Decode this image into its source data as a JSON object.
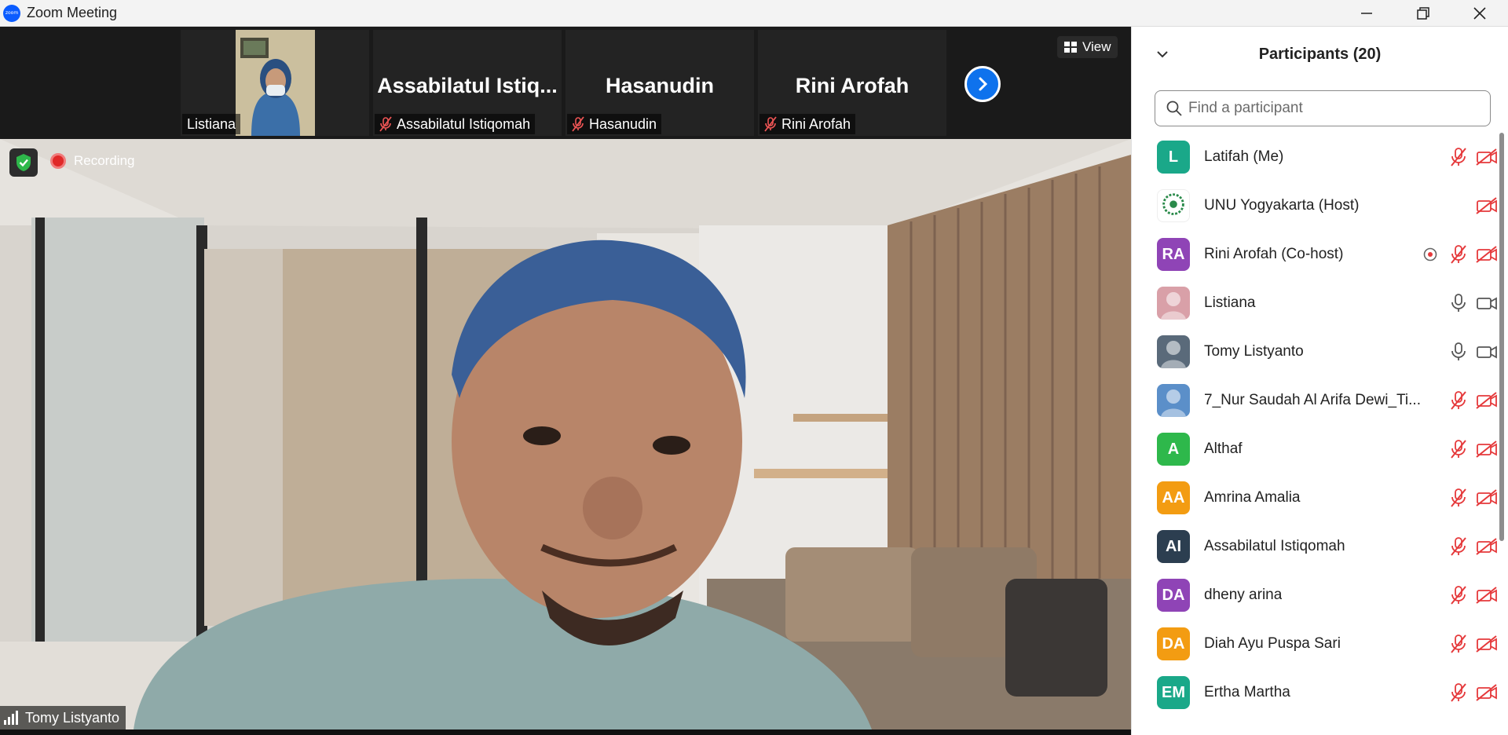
{
  "window": {
    "title": "Zoom Meeting",
    "logo_text": "zoom"
  },
  "gallery": {
    "tiles": [
      {
        "bigname": "",
        "tag": "Listiana",
        "muted": false
      },
      {
        "bigname": "Assabilatul  Istiq...",
        "tag": "Assabilatul Istiqomah",
        "muted": true
      },
      {
        "bigname": "Hasanudin",
        "tag": "Hasanudin",
        "muted": true
      },
      {
        "bigname": "Rini Arofah",
        "tag": "Rini Arofah",
        "muted": true
      }
    ],
    "view_label": "View"
  },
  "main": {
    "recording_label": "Recording",
    "speaker_name": "Tomy Listyanto"
  },
  "panel": {
    "title": "Participants (20)",
    "search_placeholder": "Find a participant",
    "participants": [
      {
        "name": "Latifah (Me)",
        "initials": "L",
        "color": "#1aa889",
        "mic": "muted",
        "video": "off",
        "record": false
      },
      {
        "name": "UNU Yogyakarta (Host)",
        "initials": "",
        "color": "#ffffff",
        "mic": "none",
        "video": "off",
        "record": false
      },
      {
        "name": "Rini Arofah (Co-host)",
        "initials": "RA",
        "color": "#8f44b6",
        "mic": "muted",
        "video": "off",
        "record": true
      },
      {
        "name": "Listiana",
        "initials": "",
        "color": "#d9a0a8",
        "mic": "on",
        "video": "on",
        "record": false
      },
      {
        "name": "Tomy Listyanto",
        "initials": "",
        "color": "#5a6a7a",
        "mic": "on",
        "video": "on",
        "record": false
      },
      {
        "name": "7_Nur Saudah Al Arifa Dewi_Ti...",
        "initials": "",
        "color": "#5b8fc9",
        "mic": "muted",
        "video": "off",
        "record": false
      },
      {
        "name": "Althaf",
        "initials": "A",
        "color": "#2eb84b",
        "mic": "muted",
        "video": "off",
        "record": false
      },
      {
        "name": "Amrina Amalia",
        "initials": "AA",
        "color": "#f39c12",
        "mic": "muted",
        "video": "off",
        "record": false
      },
      {
        "name": "Assabilatul Istiqomah",
        "initials": "AI",
        "color": "#2c3e50",
        "mic": "muted",
        "video": "off",
        "record": false
      },
      {
        "name": "dheny arina",
        "initials": "DA",
        "color": "#8f44b6",
        "mic": "muted",
        "video": "off",
        "record": false
      },
      {
        "name": "Diah Ayu Puspa Sari",
        "initials": "DA",
        "color": "#f39c12",
        "mic": "muted",
        "video": "off",
        "record": false
      },
      {
        "name": "Ertha Martha",
        "initials": "EM",
        "color": "#1aa889",
        "mic": "muted",
        "video": "off",
        "record": false
      }
    ]
  }
}
